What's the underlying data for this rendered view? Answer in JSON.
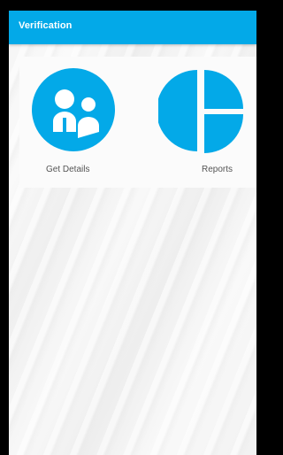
{
  "app_bar": {
    "title": "Verification",
    "color": "#03a9e8"
  },
  "tiles": [
    {
      "label": "Get Details",
      "icon": "people-icon"
    },
    {
      "label": "Reports",
      "icon": "pie-chart-icon"
    }
  ],
  "colors": {
    "accent": "#03a9e8",
    "label_text": "#555555"
  }
}
